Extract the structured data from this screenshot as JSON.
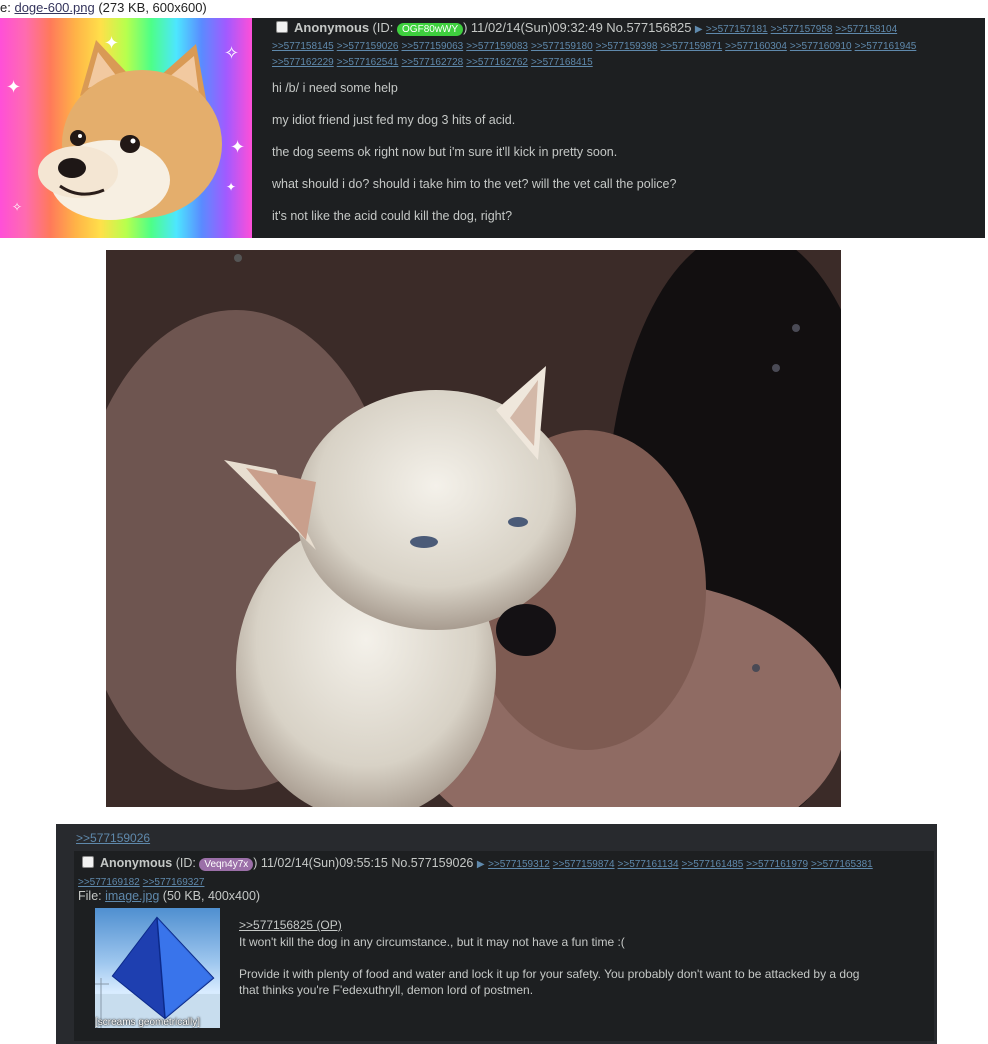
{
  "op": {
    "file_prefix": "e: ",
    "file_link": "doge-600.png",
    "file_meta": "(273 KB, 600x600)",
    "name": "Anonymous",
    "id_open": "(ID: ",
    "id": "OGF80wWY",
    "id_close": ")",
    "datetime": "11/02/14(Sun)09:32:49",
    "post_no": "No.577156825",
    "arrow": "▶",
    "replies_line1": [
      ">>577157181",
      ">>577157958",
      ">>577158104"
    ],
    "replies_line2": [
      ">>577158145",
      ">>577159026",
      ">>577159063",
      ">>577159083",
      ">>577159180",
      ">>577159398",
      ">>577159871",
      ">>577160304",
      ">>577160910",
      ">>577161945"
    ],
    "replies_line3": [
      ">>577162229",
      ">>577162541",
      ">>577162728",
      ">>577162762",
      ">>577168415"
    ],
    "message": [
      "hi /b/ i need some help",
      "my idiot friend just fed my dog 3 hits of acid.",
      "the dog seems ok right now but i'm sure it'll kick in pretty soon.",
      "what should i do? should i take him to the vet? will the vet call the police?",
      "it's not like the acid could kill the dog, right?"
    ]
  },
  "reply": {
    "quote_header": ">>577159026",
    "name": "Anonymous",
    "id_open": "(ID: ",
    "id": "Veqn4y7x",
    "id_close": ")",
    "datetime": "11/02/14(Sun)09:55:15",
    "post_no": "No.577159026",
    "arrow": "▶",
    "replies_line1": [
      ">>577159312",
      ">>577159874",
      ">>577161134",
      ">>577161485",
      ">>577161979",
      ">>577165381"
    ],
    "replies_line2": [
      ">>577169182",
      ">>577169327"
    ],
    "file_label": "File: ",
    "file_link": "image.jpg",
    "file_meta": "(50 KB, 400x400)",
    "thumb_caption": "[screams geometrically]",
    "op_link": ">>577156825 (OP)",
    "text1": "It won't kill the dog in any circumstance., but it may not have a fun time :(",
    "text2a": "Provide it with plenty of food and water and lock it up for your safety. You probably don't want to be attacked by a dog",
    "text2b": "that thinks you're F'edexuthryll, demon lord of postmen."
  },
  "colors": {
    "background": "#1d1f21",
    "reply_background": "#282a2e",
    "link": "#5f89ac",
    "op_id_badge": "#3ecf3e",
    "reply_id_badge": "#9b6fa8"
  }
}
